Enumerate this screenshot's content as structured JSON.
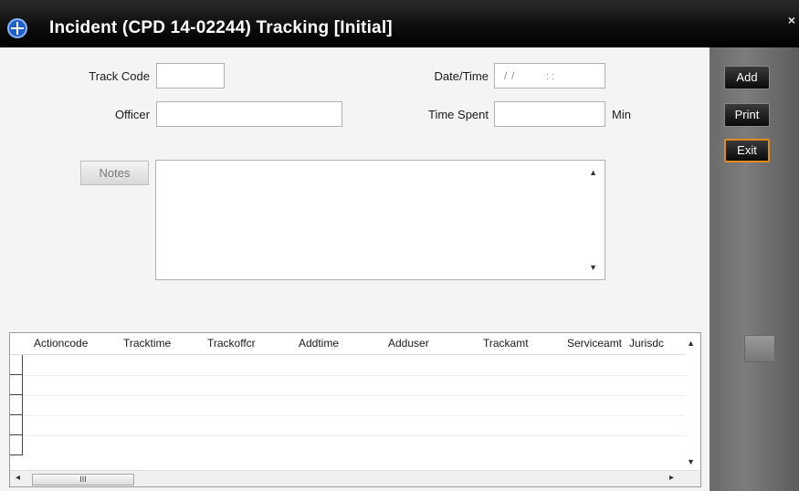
{
  "window": {
    "title": "Incident (CPD 14-02244) Tracking [Initial]",
    "close": "×"
  },
  "form": {
    "track_code_label": "Track Code",
    "track_code_value": "",
    "officer_label": "Officer",
    "officer_value": "",
    "datetime_label": "Date/Time",
    "datetime_date": "/ /",
    "datetime_time": ": :",
    "time_spent_label": "Time Spent",
    "time_spent_value": "",
    "time_spent_unit": "Min",
    "notes_button": "Notes",
    "notes_value": ""
  },
  "grid": {
    "columns": [
      "Actioncode",
      "Tracktime",
      "Trackoffcr",
      "Addtime",
      "Adduser",
      "Trackamt",
      "Serviceamt",
      "Jurisdc"
    ],
    "rows": [],
    "scroll_thumb": "III"
  },
  "side": {
    "add": "Add",
    "print": "Print",
    "exit": "Exit"
  }
}
